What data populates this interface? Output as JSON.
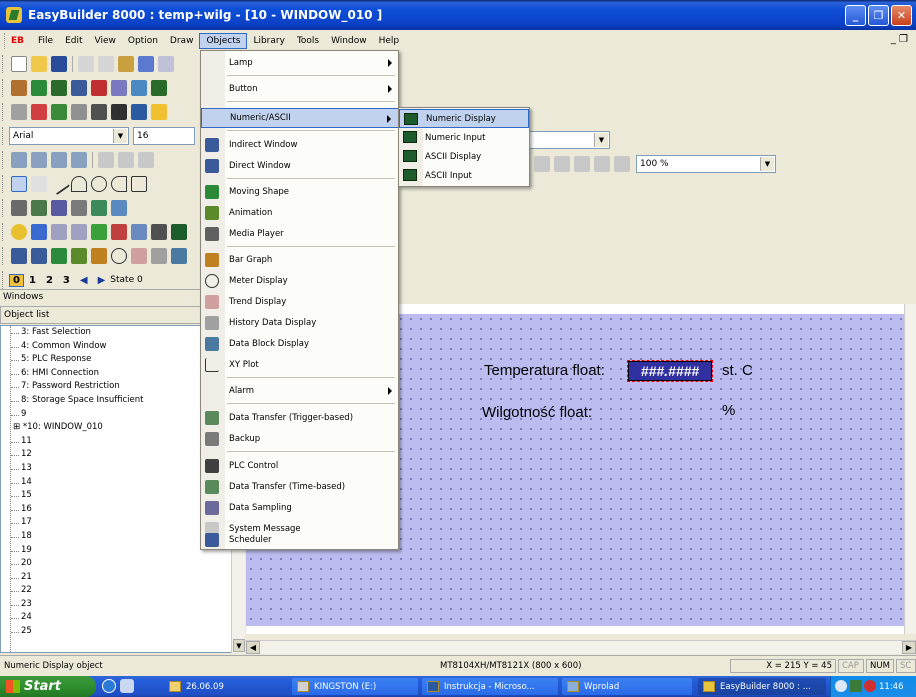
{
  "window": {
    "title": "EasyBuilder 8000 : temp+wilg - [10 - WINDOW_010 ]",
    "minimize": "_",
    "restore": "❐",
    "close": "✕"
  },
  "menubar": {
    "logo": "EB",
    "items": [
      "File",
      "Edit",
      "View",
      "Option",
      "Draw",
      "Objects",
      "Library",
      "Tools",
      "Window",
      "Help"
    ],
    "mdi_controls": "_ ❐"
  },
  "toolbars": {
    "font_name": "Arial",
    "font_size": "16",
    "zoom": "100 %",
    "state_numbers": [
      "0",
      "1",
      "2",
      "3"
    ],
    "state_label": "State 0"
  },
  "panels": {
    "windows_title": "Windows",
    "object_list_title": "Object list",
    "tree": [
      "3: Fast Selection",
      "4: Common Window",
      "5: PLC Response",
      "6: HMI Connection",
      "7: Password Restriction",
      "8: Storage Space Insufficient",
      "9",
      "*10: WINDOW_010",
      "11",
      "12",
      "13",
      "14",
      "15",
      "16",
      "17",
      "18",
      "19",
      "20",
      "21",
      "22",
      "23",
      "24",
      "25"
    ],
    "expander_symbol": "⊞"
  },
  "objects_menu": {
    "items": [
      {
        "label": "Lamp",
        "sub": true
      },
      {
        "label": "Button",
        "sub": true
      },
      {
        "label": "Numeric/ASCII",
        "sub": true,
        "highlight": true
      },
      {
        "label": "Indirect Window"
      },
      {
        "label": "Direct Window"
      },
      {
        "label": "Moving Shape"
      },
      {
        "label": "Animation"
      },
      {
        "label": "Media Player"
      },
      {
        "label": "Bar Graph"
      },
      {
        "label": "Meter Display"
      },
      {
        "label": "Trend Display"
      },
      {
        "label": "History Data Display"
      },
      {
        "label": "Data Block Display"
      },
      {
        "label": "XY Plot"
      },
      {
        "label": "Alarm",
        "sub": true
      },
      {
        "label": "Data Transfer (Trigger-based)"
      },
      {
        "label": "Backup"
      },
      {
        "label": "PLC Control"
      },
      {
        "label": "Data Transfer (Time-based)"
      },
      {
        "label": "Data Sampling"
      },
      {
        "label": "System Message"
      },
      {
        "label": "Scheduler"
      }
    ]
  },
  "numeric_submenu": {
    "items": [
      "Numeric Display",
      "Numeric Input",
      "ASCII Display",
      "ASCII Input"
    ]
  },
  "canvas": {
    "temp_label": "Temperatura float:",
    "temp_value": "###.####",
    "temp_unit": "st. C",
    "humidity_label": "Wilgotność float:",
    "humidity_unit": "%"
  },
  "statusbar": {
    "message": "Numeric Display object",
    "model": "MT8104XH/MT8121X (800 x 600)",
    "coords": "X = 215  Y = 45",
    "cap": "CAP",
    "num": "NUM",
    "scrl": "SC"
  },
  "taskbar": {
    "start": "Start",
    "buttons": [
      "26.06.09",
      "KINGSTON (E:)",
      "Instrukcja - Microso...",
      "Wprolad",
      "EasyBuilder 8000 : ..."
    ],
    "clock": "11:46"
  },
  "colors": {
    "canvas_bg": "#bcbcf0",
    "menu_highlight": "#c1d2ee",
    "titlebar": "#0b3fc4"
  }
}
